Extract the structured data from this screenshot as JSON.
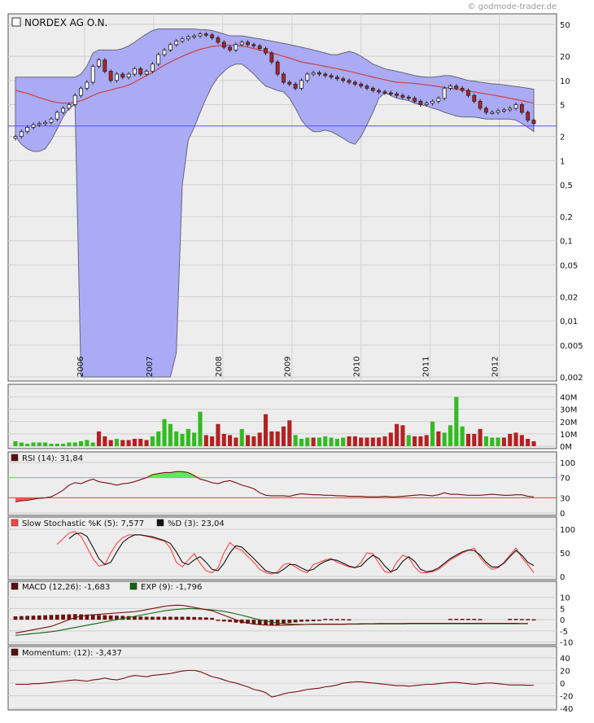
{
  "watermark": "© godmode-trader.de",
  "title": "NORDEX AG O.N.",
  "colors": {
    "band": "#aaaaf5",
    "band_edge": "#66667a",
    "ma": "#d04040",
    "up": "#33bb22",
    "down": "#b22222",
    "ref_line": "#5555ee",
    "rsi_hi": "#44ee44",
    "rsi_lo": "#ee4444",
    "slow_k": "#ff4444",
    "slow_d": "#111111",
    "macd": "#7a1010",
    "exp": "#116611",
    "momentum": "#7a1010"
  },
  "legends": {
    "rsi": "RSI (14): 31,84",
    "slow_k": "Slow Stochastic %K (5): 7,577",
    "slow_d": "%D (3): 23,04",
    "macd": "MACD (12,26): -1,683",
    "exp": "EXP (9): -1,796",
    "momentum": "Momentum: (12): -3,437"
  },
  "chart_data": [
    {
      "type": "candlestick",
      "title": "NORDEX AG O.N.",
      "y_scale": "log",
      "ylim": [
        0.002,
        50
      ],
      "x_range": [
        2005.0,
        2012.5
      ],
      "x_ticks": [
        "2006",
        "2007",
        "2008",
        "2009",
        "2010",
        "2011",
        "2012"
      ],
      "y_ticks": [
        "50",
        "20",
        "10",
        "5",
        "2",
        "1",
        "0,5",
        "0,2",
        "0,1",
        "0,05",
        "0,02",
        "0,01",
        "0,005",
        "0,002"
      ],
      "reference_line": 2.7,
      "close": [
        2.0,
        2.3,
        2.6,
        2.8,
        2.9,
        3.0,
        3.3,
        4.0,
        4.5,
        5.0,
        6.5,
        8.0,
        9.5,
        15,
        18,
        13,
        10,
        12,
        11,
        12,
        14,
        12,
        13,
        16,
        21,
        24,
        28,
        31,
        33,
        35,
        36,
        38,
        37,
        34,
        30,
        26,
        24,
        28,
        30,
        28,
        27,
        25,
        22,
        17,
        12,
        9.5,
        9.0,
        8.0,
        10,
        12,
        12.5,
        12,
        11.5,
        11,
        10.5,
        10,
        9.5,
        9.0,
        8.5,
        8.0,
        7.5,
        7.2,
        7.0,
        6.8,
        6.5,
        6.2,
        6.0,
        5.5,
        5.0,
        5.2,
        5.5,
        6.0,
        8.0,
        8.5,
        8.0,
        7.5,
        6.5,
        5.5,
        4.5,
        4.0,
        4.0,
        4.2,
        4.3,
        4.5,
        5.0,
        4.0,
        3.2,
        2.9
      ],
      "ma": [
        7.5,
        7.2,
        6.9,
        6.5,
        6.1,
        5.8,
        5.5,
        5.3,
        5.2,
        5.2,
        5.3,
        5.6,
        6.0,
        6.5,
        7.0,
        7.3,
        7.6,
        8.0,
        8.3,
        8.8,
        9.5,
        10.5,
        11.5,
        12.5,
        14.0,
        15.5,
        17.0,
        18.5,
        20.0,
        21.5,
        23.0,
        24.5,
        25.5,
        26.5,
        27.0,
        27.5,
        27.5,
        27.5,
        27.0,
        26.0,
        25.0,
        24.0,
        23.0,
        22.0,
        21.0,
        20.0,
        19.0,
        18.0,
        17.0,
        16.5,
        16.0,
        15.5,
        15.0,
        14.5,
        14.0,
        13.5,
        13.0,
        12.5,
        12.0,
        11.5,
        11.0,
        10.6,
        10.2,
        9.8,
        9.5,
        9.4,
        9.3,
        9.2,
        9.0,
        8.8,
        8.6,
        8.4,
        8.2,
        8.0,
        7.8,
        7.6,
        7.4,
        7.2,
        7.0,
        6.8,
        6.6,
        6.4,
        6.2,
        6.0,
        5.8,
        5.6,
        5.4,
        5.2
      ],
      "band_upper": [
        11,
        11,
        11,
        11,
        11,
        11,
        11,
        11,
        11,
        11,
        11,
        12,
        15,
        22,
        24,
        24,
        24,
        24,
        25,
        27,
        30,
        34,
        38,
        42,
        44,
        44,
        44,
        44,
        44,
        44,
        44,
        43,
        43,
        42,
        40,
        38,
        36,
        36,
        36,
        35,
        34,
        33,
        32,
        31,
        30,
        29,
        28,
        27,
        26,
        25,
        24,
        23,
        22,
        21,
        21,
        22,
        23,
        22,
        20,
        18,
        16,
        15,
        14,
        13.5,
        13,
        12.5,
        12,
        11.5,
        11.2,
        11,
        11,
        11.2,
        11.5,
        11.5,
        11,
        10.5,
        10,
        9.8,
        9.5,
        9.3,
        9.1,
        9.0,
        8.8,
        8.6,
        8.4,
        8.2,
        8.0,
        7.8
      ],
      "band_lower": [
        2.0,
        1.6,
        1.4,
        1.3,
        1.3,
        1.4,
        1.8,
        2.5,
        3.5,
        4.5,
        5.0,
        0.002,
        0.002,
        0.002,
        0.002,
        0.002,
        0.002,
        0.002,
        0.002,
        0.002,
        0.002,
        0.002,
        0.002,
        0.002,
        0.002,
        0.002,
        0.002,
        0.004,
        0.5,
        1.8,
        2.6,
        4.0,
        6.0,
        8.5,
        11,
        13,
        15,
        16,
        16,
        14,
        12,
        10,
        8.5,
        8.0,
        7.5,
        7.2,
        6.0,
        4.5,
        3.2,
        2.6,
        2.3,
        2.3,
        2.4,
        2.3,
        2.1,
        1.9,
        1.7,
        1.6,
        2.0,
        2.8,
        4.0,
        6.0,
        7.0,
        6.5,
        6.0,
        5.8,
        5.6,
        5.2,
        5.0,
        4.8,
        4.5,
        4.3,
        4.0,
        3.8,
        3.6,
        3.5,
        3.5,
        3.5,
        3.4,
        3.3,
        3.3,
        3.3,
        3.3,
        3.3,
        3.2,
        2.9,
        2.6,
        2.3
      ]
    },
    {
      "type": "bar",
      "name": "Volume",
      "ylim": [
        0,
        45
      ],
      "y_ticks": [
        "40M",
        "30M",
        "20M",
        "10M",
        "0M"
      ],
      "values": [
        4,
        3,
        2,
        3,
        3,
        3,
        2,
        2,
        2,
        3,
        3,
        4,
        5,
        3,
        12,
        8,
        5,
        6,
        5,
        5,
        6,
        6,
        5,
        8,
        12,
        22,
        18,
        12,
        10,
        14,
        11,
        28,
        9,
        8,
        18,
        10,
        9,
        7,
        14,
        9,
        8,
        11,
        26,
        12,
        12,
        16,
        21,
        9,
        6,
        7,
        7,
        7,
        8,
        7,
        6,
        7,
        8,
        8,
        7,
        7,
        7,
        7,
        8,
        11,
        18,
        17,
        9,
        8,
        8,
        9,
        20,
        12,
        11,
        17,
        40,
        16,
        10,
        10,
        14,
        8,
        7,
        7,
        7,
        10,
        11,
        9,
        6,
        4
      ],
      "up_flags": [
        1,
        1,
        1,
        1,
        1,
        1,
        1,
        1,
        1,
        1,
        1,
        1,
        1,
        1,
        0,
        0,
        0,
        1,
        0,
        0,
        0,
        0,
        0,
        1,
        1,
        1,
        1,
        1,
        1,
        1,
        1,
        1,
        0,
        0,
        0,
        0,
        0,
        0,
        1,
        0,
        0,
        0,
        0,
        0,
        0,
        0,
        0,
        1,
        1,
        1,
        0,
        1,
        1,
        1,
        1,
        1,
        0,
        0,
        0,
        0,
        0,
        0,
        0,
        0,
        0,
        0,
        1,
        0,
        0,
        0,
        1,
        0,
        1,
        1,
        1,
        1,
        0,
        0,
        0,
        1,
        1,
        1,
        0,
        0,
        0,
        0,
        0,
        0
      ]
    },
    {
      "type": "line",
      "name": "RSI (14)",
      "ylim": [
        0,
        100
      ],
      "y_ticks": [
        "100",
        "70",
        "30",
        "0"
      ],
      "levels": [
        70,
        30
      ],
      "values": [
        22,
        24,
        25,
        27,
        29,
        30,
        32,
        38,
        45,
        55,
        60,
        58,
        63,
        67,
        62,
        60,
        58,
        55,
        58,
        59,
        62,
        66,
        70,
        76,
        78,
        80,
        80,
        82,
        82,
        80,
        74,
        67,
        64,
        60,
        58,
        62,
        64,
        60,
        55,
        52,
        48,
        40,
        35,
        34,
        34,
        34,
        33,
        36,
        38,
        37,
        36,
        36,
        35,
        35,
        34,
        34,
        33,
        33,
        33,
        32,
        32,
        32,
        33,
        32,
        32,
        33,
        34,
        35,
        36,
        35,
        34,
        36,
        40,
        37,
        37,
        36,
        35,
        35,
        35,
        36,
        37,
        36,
        35,
        35,
        36,
        36,
        33,
        31.84
      ]
    },
    {
      "type": "line",
      "name": "Slow Stochastic",
      "ylim": [
        0,
        100
      ],
      "y_ticks": [
        "100",
        "50",
        "0"
      ],
      "series": [
        {
          "name": "Slow Stochastic %K (5)",
          "values": [
            null,
            null,
            null,
            null,
            null,
            null,
            null,
            68,
            80,
            92,
            95,
            85,
            62,
            38,
            22,
            25,
            50,
            70,
            82,
            88,
            88,
            88,
            85,
            82,
            78,
            75,
            60,
            30,
            20,
            35,
            48,
            28,
            12,
            8,
            18,
            50,
            72,
            60,
            55,
            42,
            30,
            15,
            8,
            5,
            10,
            25,
            28,
            20,
            12,
            8,
            25,
            30,
            35,
            38,
            30,
            25,
            20,
            18,
            30,
            50,
            48,
            28,
            10,
            8,
            30,
            45,
            40,
            20,
            8,
            7.577,
            10,
            15,
            25,
            35,
            42,
            50,
            55,
            60,
            40,
            25,
            15,
            18,
            30,
            45,
            60,
            40,
            25,
            8
          ]
        },
        {
          "name": "%D (3)",
          "values": [
            null,
            null,
            null,
            null,
            null,
            null,
            null,
            null,
            null,
            80,
            90,
            92,
            85,
            62,
            38,
            25,
            30,
            52,
            72,
            82,
            88,
            88,
            86,
            84,
            80,
            76,
            70,
            52,
            30,
            25,
            35,
            42,
            30,
            15,
            12,
            28,
            50,
            65,
            62,
            50,
            38,
            25,
            12,
            8,
            7,
            15,
            25,
            25,
            18,
            12,
            15,
            25,
            32,
            36,
            34,
            28,
            22,
            19,
            22,
            35,
            45,
            38,
            22,
            10,
            15,
            32,
            42,
            32,
            15,
            10,
            12,
            18,
            28,
            38,
            45,
            52,
            56,
            55,
            45,
            30,
            20,
            20,
            28,
            42,
            55,
            45,
            30,
            23.04
          ]
        }
      ]
    },
    {
      "type": "line",
      "name": "MACD",
      "ylim": [
        -12,
        15
      ],
      "y_ticks": [
        "10",
        "5",
        "0",
        "-5",
        "-10"
      ],
      "series": [
        {
          "name": "MACD (12,26)",
          "values": [
            -6,
            -5.5,
            -5,
            -4.5,
            -4,
            -3.5,
            -3,
            -2,
            -1,
            0,
            1,
            1.5,
            2,
            2.2,
            2.4,
            2.6,
            2.8,
            3.0,
            3.2,
            3.4,
            3.6,
            4,
            4.5,
            5,
            5.5,
            6,
            6.3,
            6.5,
            6.4,
            6,
            5.5,
            5,
            4.5,
            4,
            3,
            2,
            1,
            0,
            -1,
            -1.5,
            -2,
            -2.2,
            -2.4,
            -2.5,
            -2.5,
            -2.5,
            -2.4,
            -2.3,
            -2.2,
            -2.1,
            -2,
            -2,
            -2,
            -2,
            -2,
            -2,
            -1.9,
            -1.9,
            -1.8,
            -1.8,
            -1.8,
            -1.7,
            -1.7,
            -1.7,
            -1.7,
            -1.7,
            -1.6,
            -1.6,
            -1.6,
            -1.6,
            -1.6,
            -1.6,
            -1.6,
            -1.6,
            -1.6,
            -1.6,
            -1.6,
            -1.6,
            -1.6,
            -1.6,
            -1.6,
            -1.6,
            -1.6,
            -1.6,
            -1.6,
            -1.7,
            -1.683
          ]
        },
        {
          "name": "EXP (9)",
          "values": [
            -7,
            -6.8,
            -6.5,
            -6.2,
            -6,
            -5.7,
            -5.4,
            -5,
            -4.5,
            -4,
            -3.5,
            -3,
            -2.5,
            -2,
            -1.5,
            -1,
            -0.5,
            0,
            0.5,
            1,
            1.5,
            2,
            2.5,
            3,
            3.5,
            4,
            4.3,
            4.6,
            4.8,
            5,
            4.9,
            4.8,
            4.6,
            4.4,
            4.1,
            3.7,
            3.2,
            2.6,
            2,
            1.3,
            0.6,
            0,
            -0.6,
            -1.1,
            -1.5,
            -1.8,
            -2,
            -2.1,
            -2.1,
            -2.1,
            -2.1,
            -2.1,
            -2.1,
            -2.1,
            -2.1,
            -2.1,
            -2.0,
            -2.0,
            -2.0,
            -1.9,
            -1.9,
            -1.9,
            -1.9,
            -1.9,
            -1.9,
            -1.9,
            -1.8,
            -1.8,
            -1.8,
            -1.8,
            -1.8,
            -1.8,
            -1.8,
            -1.8,
            -1.8,
            -1.8,
            -1.8,
            -1.8,
            -1.8,
            -1.8,
            -1.8,
            -1.8,
            -1.8,
            -1.8,
            -1.8,
            -1.8,
            -1.796
          ]
        },
        {
          "name": "Histogram",
          "values": [
            1.5,
            1.6,
            1.7,
            1.8,
            1.9,
            2,
            2.1,
            2.2,
            2.3,
            2.4,
            2.5,
            2.4,
            2.3,
            2.2,
            2.1,
            2,
            1.9,
            1.8,
            1.7,
            1.6,
            1.5,
            1.4,
            1.3,
            1.3,
            1.3,
            1.3,
            1.3,
            1.3,
            1.3,
            1.3,
            1.2,
            1.1,
            1,
            0.8,
            -0.5,
            -0.8,
            -1,
            -1.3,
            -1.6,
            -1.8,
            -2,
            -2.2,
            -2.4,
            -2.5,
            -2.5,
            -1.8,
            -1.5,
            -1.2,
            -0.9,
            -0.8,
            -0.7,
            -0.5,
            0.4,
            0.3,
            0.3,
            0.3,
            0.2,
            0,
            0,
            0,
            0,
            0,
            0,
            0,
            0,
            0,
            0,
            0,
            0,
            0,
            0,
            0,
            0,
            0.4,
            0.4,
            0.4,
            0.4,
            0.4,
            0.3,
            0,
            0,
            0,
            0,
            0.4,
            0.4,
            0.3,
            0.3,
            0.2
          ]
        }
      ]
    },
    {
      "type": "line",
      "name": "Momentum (12)",
      "ylim": [
        -45,
        50
      ],
      "y_ticks": [
        "40",
        "20",
        "0",
        "-20",
        "-40"
      ],
      "values": [
        -2,
        -2,
        -2,
        -1,
        -1,
        0,
        1,
        2,
        3,
        4,
        5,
        4,
        3,
        5,
        6,
        8,
        6,
        5,
        7,
        10,
        12,
        11,
        10,
        12,
        13,
        14,
        15,
        17,
        19,
        20,
        20,
        18,
        14,
        10,
        8,
        5,
        2,
        0,
        -3,
        -6,
        -10,
        -12,
        -15,
        -22,
        -20,
        -17,
        -15,
        -14,
        -12,
        -10,
        -9,
        -8,
        -6,
        -5,
        -3,
        0,
        1,
        2,
        2,
        1,
        0,
        -1,
        -2,
        -3,
        -4,
        -4,
        -5,
        -4,
        -3,
        -2,
        -2,
        -1,
        0,
        1,
        1,
        0,
        -1,
        -2,
        -1,
        0,
        0,
        -1,
        -2,
        -3,
        -3,
        -3,
        -3.5,
        -3.437
      ]
    }
  ]
}
